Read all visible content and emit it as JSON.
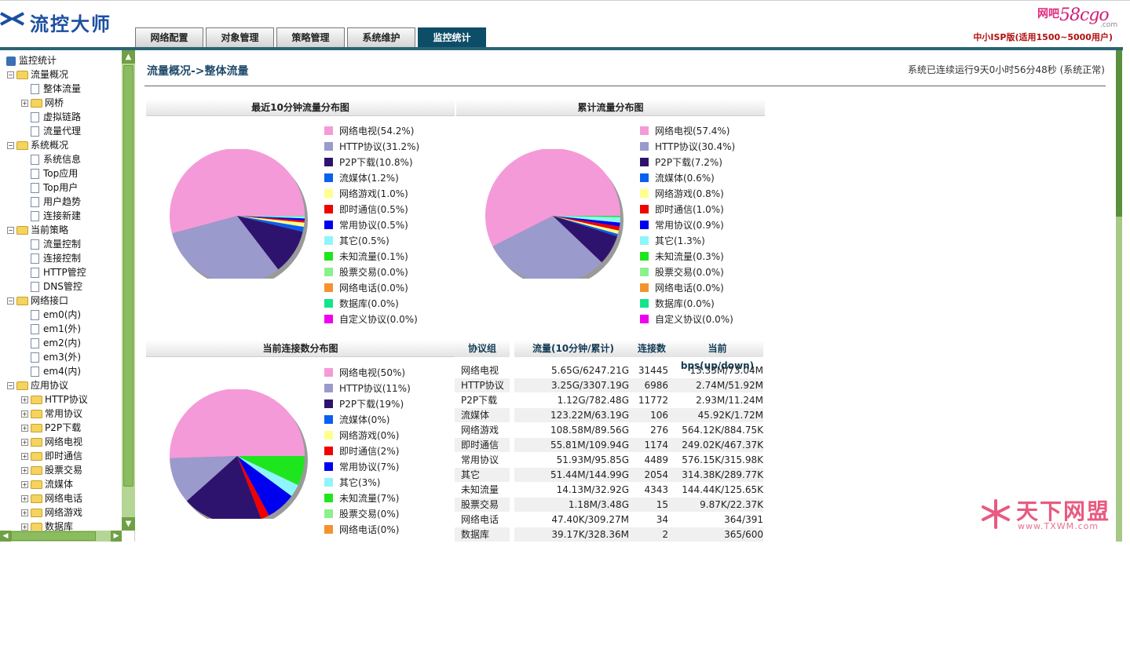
{
  "header": {
    "logo_text": "流控大师",
    "tabs": [
      {
        "label": "网络配置",
        "active": false
      },
      {
        "label": "对象管理",
        "active": false
      },
      {
        "label": "策略管理",
        "active": false
      },
      {
        "label": "系统维护",
        "active": false
      },
      {
        "label": "监控统计",
        "active": true
      }
    ],
    "brand_net": "网吧",
    "brand_num": "58cgo",
    "brand_com": ".com",
    "edition": "中小ISP版(适用1500~5000用户)"
  },
  "sidebar": {
    "nodes": [
      {
        "label": "监控统计",
        "level": 0,
        "kind": "root"
      },
      {
        "label": "流量概况",
        "level": 1,
        "kind": "folder",
        "toggle": "−"
      },
      {
        "label": "整体流量",
        "level": 2,
        "kind": "file"
      },
      {
        "label": "网桥",
        "level": 2,
        "kind": "folder",
        "toggle": "+"
      },
      {
        "label": "虚拟链路",
        "level": 2,
        "kind": "file"
      },
      {
        "label": "流量代理",
        "level": 2,
        "kind": "file"
      },
      {
        "label": "系统概况",
        "level": 1,
        "kind": "folder",
        "toggle": "−"
      },
      {
        "label": "系统信息",
        "level": 2,
        "kind": "file"
      },
      {
        "label": "Top应用",
        "level": 2,
        "kind": "file"
      },
      {
        "label": "Top用户",
        "level": 2,
        "kind": "file"
      },
      {
        "label": "用户趋势",
        "level": 2,
        "kind": "file"
      },
      {
        "label": "连接新建",
        "level": 2,
        "kind": "file"
      },
      {
        "label": "当前策略",
        "level": 1,
        "kind": "folder",
        "toggle": "−"
      },
      {
        "label": "流量控制",
        "level": 2,
        "kind": "file"
      },
      {
        "label": "连接控制",
        "level": 2,
        "kind": "file"
      },
      {
        "label": "HTTP管控",
        "level": 2,
        "kind": "file"
      },
      {
        "label": "DNS管控",
        "level": 2,
        "kind": "file"
      },
      {
        "label": "网络接口",
        "level": 1,
        "kind": "folder",
        "toggle": "−"
      },
      {
        "label": "em0(内)",
        "level": 2,
        "kind": "file"
      },
      {
        "label": "em1(外)",
        "level": 2,
        "kind": "file"
      },
      {
        "label": "em2(内)",
        "level": 2,
        "kind": "file"
      },
      {
        "label": "em3(外)",
        "level": 2,
        "kind": "file"
      },
      {
        "label": "em4(内)",
        "level": 2,
        "kind": "file"
      },
      {
        "label": "应用协议",
        "level": 1,
        "kind": "folder",
        "toggle": "−"
      },
      {
        "label": "HTTP协议",
        "level": 2,
        "kind": "folder",
        "toggle": "+"
      },
      {
        "label": "常用协议",
        "level": 2,
        "kind": "folder",
        "toggle": "+"
      },
      {
        "label": "P2P下载",
        "level": 2,
        "kind": "folder",
        "toggle": "+"
      },
      {
        "label": "网络电视",
        "level": 2,
        "kind": "folder",
        "toggle": "+"
      },
      {
        "label": "即时通信",
        "level": 2,
        "kind": "folder",
        "toggle": "+"
      },
      {
        "label": "股票交易",
        "level": 2,
        "kind": "folder",
        "toggle": "+"
      },
      {
        "label": "流媒体",
        "level": 2,
        "kind": "folder",
        "toggle": "+"
      },
      {
        "label": "网络电话",
        "level": 2,
        "kind": "folder",
        "toggle": "+"
      },
      {
        "label": "网络游戏",
        "level": 2,
        "kind": "folder",
        "toggle": "+"
      },
      {
        "label": "数据库",
        "level": 2,
        "kind": "folder",
        "toggle": "+"
      }
    ]
  },
  "main": {
    "breadcrumb": "流量概况->整体流量",
    "status": "系统已连续运行9天0小时56分48秒 (系统正常)"
  },
  "chart_data": [
    {
      "type": "pie",
      "title": "最近10分钟流量分布图",
      "categories": [
        "网络电视",
        "HTTP协议",
        "P2P下载",
        "流媒体",
        "网络游戏",
        "即时通信",
        "常用协议",
        "其它",
        "未知流量",
        "股票交易",
        "网络电话",
        "数据库",
        "自定义协议"
      ],
      "labels": [
        "网络电视(54.2%)",
        "HTTP协议(31.2%)",
        "P2P下载(10.8%)",
        "流媒体(1.2%)",
        "网络游戏(1.0%)",
        "即时通信(0.5%)",
        "常用协议(0.5%)",
        "其它(0.5%)",
        "未知流量(0.1%)",
        "股票交易(0.0%)",
        "网络电话(0.0%)",
        "数据库(0.0%)",
        "自定义协议(0.0%)"
      ],
      "values": [
        54.2,
        31.2,
        10.8,
        1.2,
        1.0,
        0.5,
        0.5,
        0.5,
        0.1,
        0.0,
        0.0,
        0.0,
        0.0
      ]
    },
    {
      "type": "pie",
      "title": "累计流量分布图",
      "categories": [
        "网络电视",
        "HTTP协议",
        "P2P下载",
        "流媒体",
        "网络游戏",
        "即时通信",
        "常用协议",
        "其它",
        "未知流量",
        "股票交易",
        "网络电话",
        "数据库",
        "自定义协议"
      ],
      "labels": [
        "网络电视(57.4%)",
        "HTTP协议(30.4%)",
        "P2P下载(7.2%)",
        "流媒体(0.6%)",
        "网络游戏(0.8%)",
        "即时通信(1.0%)",
        "常用协议(0.9%)",
        "其它(1.3%)",
        "未知流量(0.3%)",
        "股票交易(0.0%)",
        "网络电话(0.0%)",
        "数据库(0.0%)",
        "自定义协议(0.0%)"
      ],
      "values": [
        57.4,
        30.4,
        7.2,
        0.6,
        0.8,
        1.0,
        0.9,
        1.3,
        0.3,
        0.0,
        0.0,
        0.0,
        0.0
      ]
    },
    {
      "type": "pie",
      "title": "当前连接数分布图",
      "categories": [
        "网络电视",
        "HTTP协议",
        "P2P下载",
        "流媒体",
        "网络游戏",
        "即时通信",
        "常用协议",
        "其它",
        "未知流量",
        "股票交易",
        "网络电话"
      ],
      "labels": [
        "网络电视(50%)",
        "HTTP协议(11%)",
        "P2P下载(19%)",
        "流媒体(0%)",
        "网络游戏(0%)",
        "即时通信(2%)",
        "常用协议(7%)",
        "其它(3%)",
        "未知流量(7%)",
        "股票交易(0%)",
        "网络电话(0%)"
      ],
      "values": [
        50,
        11,
        19,
        0,
        0,
        2,
        7,
        3,
        7,
        0,
        0
      ]
    },
    {
      "type": "table",
      "columns": [
        "协议组",
        "流量(10分钟/累计)",
        "连接数",
        "当前bps(up/down)"
      ],
      "rows": [
        [
          "网络电视",
          "5.65G/6247.21G",
          "31445",
          "13.35M/73.04M"
        ],
        [
          "HTTP协议",
          "3.25G/3307.19G",
          "6986",
          "2.74M/51.92M"
        ],
        [
          "P2P下载",
          "1.12G/782.48G",
          "11772",
          "2.93M/11.24M"
        ],
        [
          "流媒体",
          "123.22M/63.19G",
          "106",
          "45.92K/1.72M"
        ],
        [
          "网络游戏",
          "108.58M/89.56G",
          "276",
          "564.12K/884.75K"
        ],
        [
          "即时通信",
          "55.81M/109.94G",
          "1174",
          "249.02K/467.37K"
        ],
        [
          "常用协议",
          "51.93M/95.85G",
          "4489",
          "576.15K/315.98K"
        ],
        [
          "其它",
          "51.44M/144.99G",
          "2054",
          "314.38K/289.77K"
        ],
        [
          "未知流量",
          "14.13M/32.92G",
          "4343",
          "144.44K/125.65K"
        ],
        [
          "股票交易",
          "1.18M/3.48G",
          "15",
          "9.87K/22.37K"
        ],
        [
          "网络电话",
          "47.40K/309.27M",
          "34",
          "364/391"
        ],
        [
          "数据库",
          "39.17K/328.36M",
          "2",
          "365/600"
        ]
      ]
    }
  ],
  "colors": {
    "slices": [
      "#f59ad8",
      "#9a9acc",
      "#2e136e",
      "#0a5ff0",
      "#ffff8c",
      "#f00000",
      "#0000f0",
      "#8ef6fa",
      "#1ee61e",
      "#8cf08c",
      "#f4922e",
      "#12e58c",
      "#f000f0"
    ],
    "header_bar": "#2a6375",
    "active_tab": "#0d4d68",
    "edition_text": "#b01010"
  },
  "watermark": {
    "title": "天下网盟",
    "url": "www.TXWM.com"
  }
}
